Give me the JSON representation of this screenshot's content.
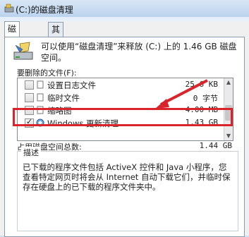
{
  "window": {
    "title": "(C:)的磁盘清理"
  },
  "tabs": [
    {
      "label": "磁盘清理",
      "active": true
    },
    {
      "label": "其他选项",
      "active": false
    }
  ],
  "info": {
    "text": "可以使用“磁盘清理”来释放  (C:) 上的 1.46 GB 磁盘空间。"
  },
  "list_label": "要删除的文件(F):",
  "files": [
    {
      "name": "设置日志文件",
      "size": "25.6 KB",
      "checked": false,
      "icon": "file-icon"
    },
    {
      "name": "临时文件",
      "size": "0 字节",
      "checked": false,
      "icon": "file-icon"
    },
    {
      "name": "缩略图",
      "size": "4.00 MB",
      "checked": false,
      "icon": "file-icon"
    },
    {
      "name": "Windows 更新清理",
      "size": "1.43 GB",
      "checked": true,
      "icon": "windows-update-icon"
    }
  ],
  "total": {
    "label": "占用磁盘空间总数:",
    "value": "1.44 GB"
  },
  "description": {
    "title": "描述",
    "text": "已下载的程序文件包括 ActiveX 控件和 Java 小程序，您查看特定网页时将会从 Internet 自动下载它们，并临时保存在硬盘上的已下载的程序文件夹中。"
  },
  "colors": {
    "highlight": "#d8242a",
    "arrow": "#d8242a"
  }
}
